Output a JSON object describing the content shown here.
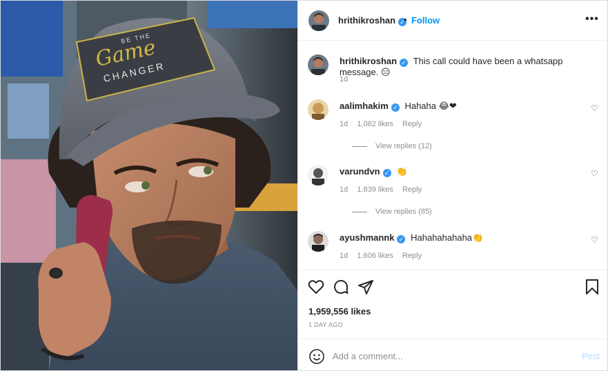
{
  "post": {
    "author": "hrithikroshan",
    "follow_label": "Follow",
    "dot": "•",
    "more": "•••"
  },
  "caption": {
    "username": "hrithikroshan",
    "text": "This call could have been a whatsapp message.",
    "emoji": "😑",
    "time": "1d"
  },
  "photo": {
    "cap_text_top": "BE THE",
    "cap_text_script": "Game",
    "cap_text_bottom": "CHANGER"
  },
  "comments": [
    {
      "username": "aalimhakim",
      "text": "Hahaha",
      "emoji": "😂❤",
      "time": "1d",
      "likes": "1,082 likes",
      "reply": "Reply",
      "view_replies": "View replies (12)"
    },
    {
      "username": "varundvn",
      "text": "",
      "emoji": "👏",
      "time": "1d",
      "likes": "1,839 likes",
      "reply": "Reply",
      "view_replies": "View replies (85)"
    },
    {
      "username": "ayushmannk",
      "text": "Hahahahahaha",
      "emoji": "👏",
      "time": "1d",
      "likes": "1,606 likes",
      "reply": "Reply"
    }
  ],
  "stats": {
    "likes": "1,959,556 likes",
    "time_ago": "1 DAY AGO"
  },
  "add_comment": {
    "placeholder": "Add a comment...",
    "post_label": "Post"
  },
  "icons": {
    "verified": "verified-badge-icon",
    "like": "heart-icon",
    "comment": "comment-bubble-icon",
    "share": "paper-plane-icon",
    "save": "bookmark-icon",
    "emoji": "smiley-icon",
    "comment_like": "small-heart-icon"
  },
  "colors": {
    "link_blue": "#0095f6",
    "verified_blue": "#3897f0",
    "muted": "#8e8e8e",
    "post_disabled": "#b3dbff"
  }
}
